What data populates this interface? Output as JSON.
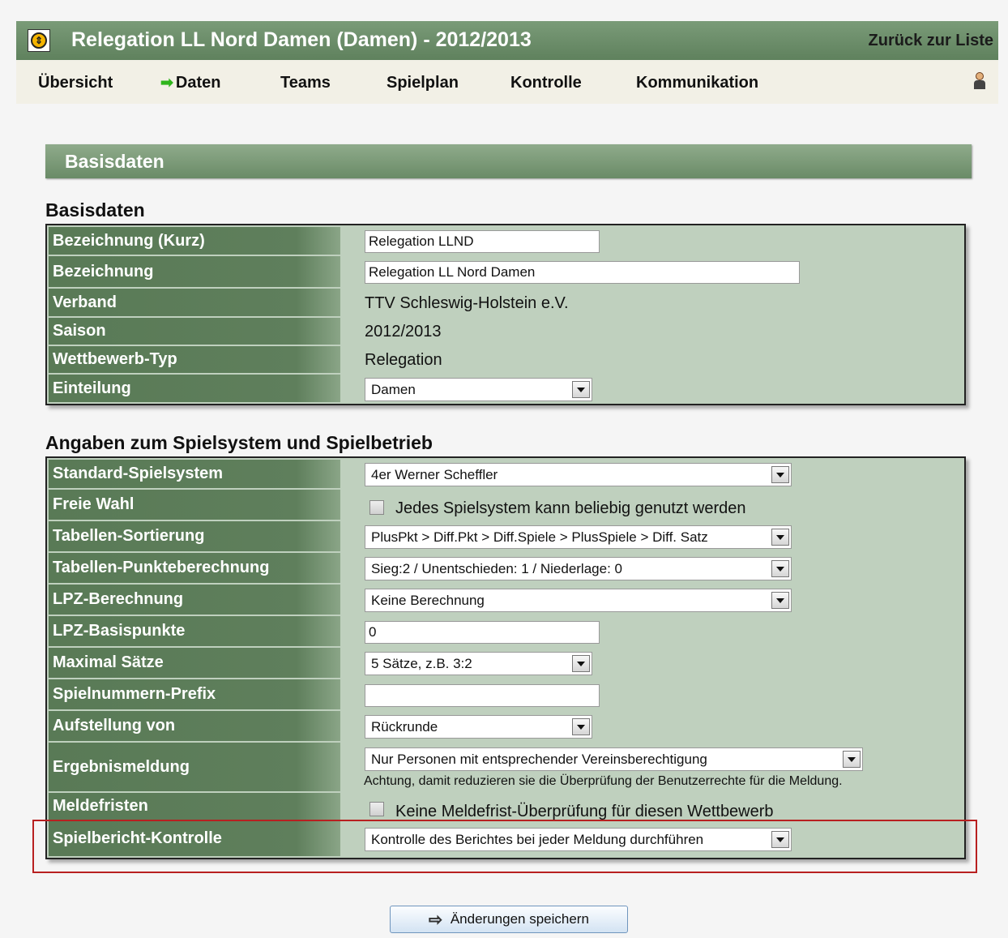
{
  "header": {
    "title": "Relegation LL Nord Damen (Damen) - 2012/2013",
    "back_link": "Zurück zur Liste"
  },
  "nav": {
    "items": [
      "Übersicht",
      "Daten",
      "Teams",
      "Spielplan",
      "Kontrolle",
      "Kommunikation"
    ],
    "active": "Daten",
    "active_icon": "arrow-right-icon"
  },
  "section_title": "Basisdaten",
  "basis": {
    "heading": "Basisdaten",
    "kurz_label": "Bezeichnung (Kurz)",
    "kurz_value": "Relegation LLND",
    "bez_label": "Bezeichnung",
    "bez_value": "Relegation LL Nord Damen",
    "verband_label": "Verband",
    "verband_value": "TTV Schleswig-Holstein e.V.",
    "saison_label": "Saison",
    "saison_value": "2012/2013",
    "typ_label": "Wettbewerb-Typ",
    "typ_value": "Relegation",
    "einteilung_label": "Einteilung",
    "einteilung_value": "Damen"
  },
  "spiel": {
    "heading": "Angaben zum Spielsystem und Spielbetrieb",
    "standard_label": "Standard-Spielsystem",
    "standard_value": "4er Werner Scheffler",
    "freie_label": "Freie Wahl",
    "freie_text": "Jedes Spielsystem kann beliebig genutzt werden",
    "sort_label": "Tabellen-Sortierung",
    "sort_value": "PlusPkt > Diff.Pkt > Diff.Spiele > PlusSpiele > Diff. Satz",
    "punkte_label": "Tabellen-Punkteberechnung",
    "punkte_value": "Sieg:2 / Unentschieden: 1 / Niederlage: 0",
    "lpz_label": "LPZ-Berechnung",
    "lpz_value": "Keine Berechnung",
    "lpzbasis_label": "LPZ-Basispunkte",
    "lpzbasis_value": "0",
    "saetze_label": "Maximal Sätze",
    "saetze_value": "5 Sätze, z.B. 3:2",
    "prefix_label": "Spielnummern-Prefix",
    "prefix_value": "",
    "aufstellung_label": "Aufstellung von",
    "aufstellung_value": "Rückrunde",
    "ergebnis_label": "Ergebnismeldung",
    "ergebnis_value": "Nur Personen mit entsprechender Vereinsberechtigung",
    "ergebnis_note": "Achtung, damit reduzieren sie die Überprüfung der Benutzerrechte für die Meldung.",
    "fristen_label": "Meldefristen",
    "fristen_text": "Keine Meldefrist-Überprüfung für diesen Wettbewerb",
    "kontrolle_label": "Spielbericht-Kontrolle",
    "kontrolle_value": "Kontrolle des Berichtes bei jeder Meldung durchführen"
  },
  "save_button": "Änderungen speichern",
  "colors": {
    "header_green": "#6b8c68",
    "label_green": "#5f7f5c",
    "panel_bg": "#bfd0be",
    "highlight": "#b82020"
  }
}
